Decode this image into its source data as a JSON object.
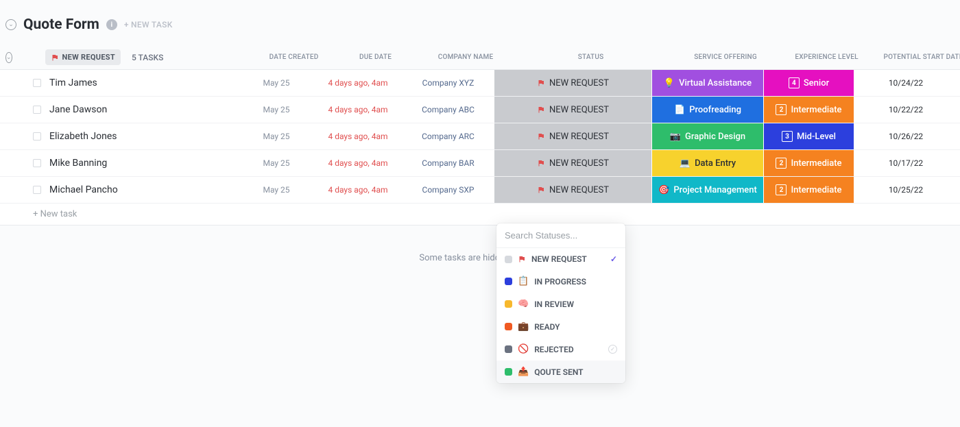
{
  "page": {
    "title": "Quote Form",
    "new_task_link": "+ NEW TASK"
  },
  "group": {
    "badge": "NEW REQUEST",
    "task_count": "5 TASKS",
    "new_task_row": "+ New task"
  },
  "columns": {
    "date_created": "DATE CREATED",
    "due_date": "DUE DATE",
    "company": "COMPANY NAME",
    "status": "STATUS",
    "service": "SERVICE OFFERING",
    "level": "EXPERIENCE LEVEL",
    "start": "POTENTIAL START DATE"
  },
  "rows": [
    {
      "name": "Tim James",
      "created": "May 25",
      "due": "4 days ago, 4am",
      "company": "Company XYZ",
      "status": "NEW REQUEST",
      "service": "Virtual Assistance",
      "service_icon": "💡",
      "service_color": "svc-purple",
      "level": "Senior",
      "level_num": "4",
      "level_color": "lvl-magenta",
      "start": "10/24/22"
    },
    {
      "name": "Jane Dawson",
      "created": "May 25",
      "due": "4 days ago, 4am",
      "company": "Company ABC",
      "status": "NEW REQUEST",
      "service": "Proofreading",
      "service_icon": "📄",
      "service_color": "svc-blue",
      "level": "Intermediate",
      "level_num": "2",
      "level_color": "lvl-orange",
      "start": "10/22/22"
    },
    {
      "name": "Elizabeth Jones",
      "created": "May 25",
      "due": "4 days ago, 4am",
      "company": "Company ARC",
      "status": "NEW REQUEST",
      "service": "Graphic Design",
      "service_icon": "📷",
      "service_color": "svc-green",
      "level": "Mid-Level",
      "level_num": "3",
      "level_color": "lvl-dblue",
      "start": "10/26/22"
    },
    {
      "name": "Mike Banning",
      "created": "May 25",
      "due": "4 days ago, 4am",
      "company": "Company BAR",
      "status": "NEW REQUEST",
      "service": "Data Entry",
      "service_icon": "💻",
      "service_color": "svc-yellow",
      "level": "Intermediate",
      "level_num": "2",
      "level_color": "lvl-orange",
      "start": "10/17/22"
    },
    {
      "name": "Michael Pancho",
      "created": "May 25",
      "due": "4 days ago, 4am",
      "company": "Company SXP",
      "status": "NEW REQUEST",
      "service": "Project Management",
      "service_icon": "🎯",
      "service_color": "svc-teal",
      "level": "Intermediate",
      "level_num": "2",
      "level_color": "lvl-orange",
      "start": "10/25/22"
    }
  ],
  "hidden_msg": "Some tasks are hidden. To sho",
  "popover": {
    "placeholder": "Search Statuses...",
    "statuses": [
      {
        "label": "NEW REQUEST",
        "dot": "#d6d9de",
        "icon": "flag-red",
        "selected": true,
        "hovered": false
      },
      {
        "label": "IN PROGRESS",
        "dot": "#2c3fdd",
        "icon": "📋",
        "selected": false,
        "hovered": false
      },
      {
        "label": "IN REVIEW",
        "dot": "#f7b82d",
        "icon": "🧠",
        "selected": false,
        "hovered": false
      },
      {
        "label": "READY",
        "dot": "#f05a22",
        "icon": "💼",
        "selected": false,
        "hovered": false
      },
      {
        "label": "REJECTED",
        "dot": "#6b7280",
        "icon": "🚫",
        "selected": false,
        "hovered": false,
        "circle": true
      },
      {
        "label": "QOUTE SENT",
        "dot": "#2ebd6b",
        "icon": "📤",
        "selected": false,
        "hovered": true
      }
    ]
  }
}
